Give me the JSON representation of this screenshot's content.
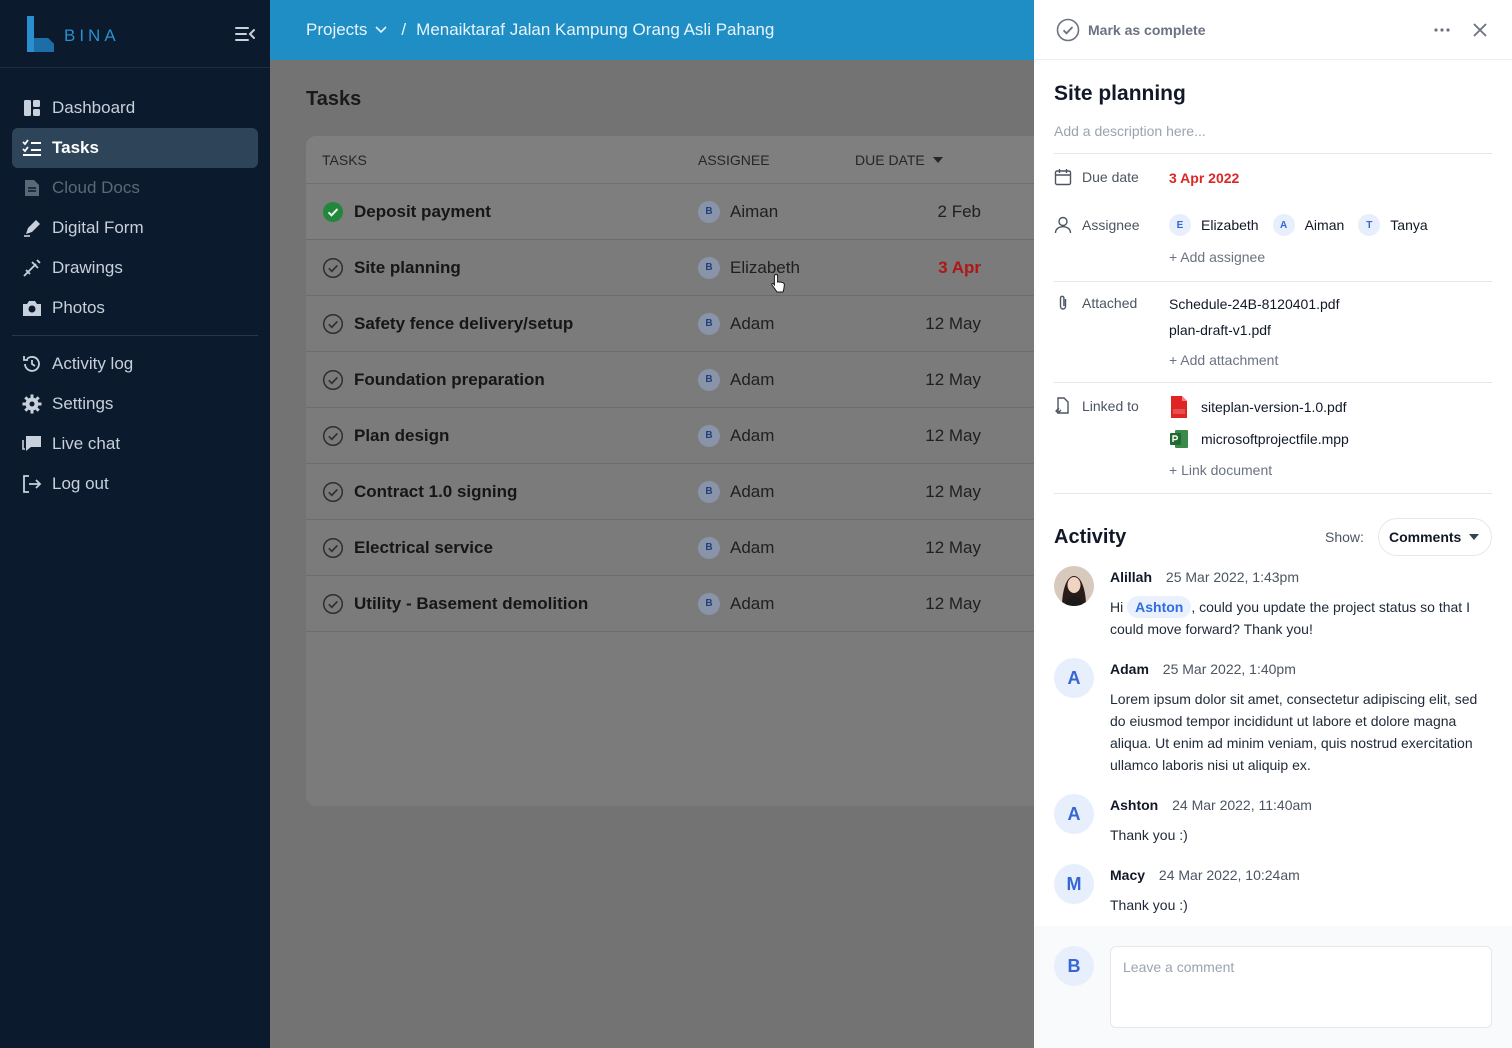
{
  "brand": {
    "name": "BINA",
    "accent": "#2a8fd0"
  },
  "sidebar": {
    "items": [
      {
        "label": "Dashboard",
        "icon": "dashboard-icon"
      },
      {
        "label": "Tasks",
        "icon": "tasks-icon",
        "active": true
      },
      {
        "label": "Cloud Docs",
        "icon": "document-icon",
        "disabled": true
      },
      {
        "label": "Digital Form",
        "icon": "pen-icon"
      },
      {
        "label": "Drawings",
        "icon": "drawing-icon"
      },
      {
        "label": "Photos",
        "icon": "camera-icon"
      },
      {
        "label": "Activity log",
        "icon": "history-icon"
      },
      {
        "label": "Settings",
        "icon": "gear-icon"
      },
      {
        "label": "Live chat",
        "icon": "chat-icon"
      },
      {
        "label": "Log out",
        "icon": "logout-icon"
      }
    ]
  },
  "topbar": {
    "breadcrumb_root": "Projects",
    "separator": "/",
    "project_name": "Menaiktaraf Jalan Kampung Orang Asli Pahang"
  },
  "main": {
    "title": "Tasks",
    "table": {
      "headers": {
        "task": "TASKS",
        "assignee": "ASSIGNEE",
        "due": "DUE DATE"
      },
      "rows": [
        {
          "task": "Deposit payment",
          "initial": "B",
          "assignee": "Aiman",
          "due": "2 Feb",
          "done": true
        },
        {
          "task": "Site planning",
          "initial": "B",
          "assignee": "Elizabeth",
          "due": "3 Apr",
          "overdue": true
        },
        {
          "task": "Safety fence delivery/setup",
          "initial": "B",
          "assignee": "Adam",
          "due": "12 May"
        },
        {
          "task": "Foundation preparation",
          "initial": "B",
          "assignee": "Adam",
          "due": "12 May"
        },
        {
          "task": "Plan design",
          "initial": "B",
          "assignee": "Adam",
          "due": "12 May"
        },
        {
          "task": "Contract 1.0 signing",
          "initial": "B",
          "assignee": "Adam",
          "due": "12 May"
        },
        {
          "task": "Electrical service",
          "initial": "B",
          "assignee": "Adam",
          "due": "12 May"
        },
        {
          "task": "Utility - Basement demolition",
          "initial": "B",
          "assignee": "Adam",
          "due": "12 May"
        }
      ]
    }
  },
  "panel": {
    "mark_complete": "Mark as complete",
    "title": "Site planning",
    "description_placeholder": "Add a description here...",
    "due_label": "Due date",
    "due_value": "3 Apr 2022",
    "assignee_label": "Assignee",
    "assignees": [
      {
        "initial": "E",
        "name": "Elizabeth"
      },
      {
        "initial": "A",
        "name": "Aiman"
      },
      {
        "initial": "T",
        "name": "Tanya"
      }
    ],
    "add_assignee": "+ Add assignee",
    "attached_label": "Attached",
    "attachments": [
      "Schedule-24B-8120401.pdf",
      "plan-draft-v1.pdf"
    ],
    "add_attachment": "+ Add attachment",
    "linked_label": "Linked to",
    "linked_docs": [
      {
        "name": "siteplan-version-1.0.pdf",
        "icon": "pdf-file-icon"
      },
      {
        "name": "microsoftprojectfile.mpp",
        "icon": "project-file-icon"
      }
    ],
    "link_document": "+ Link document",
    "activity_title": "Activity",
    "show_label": "Show:",
    "show_value": "Comments",
    "comments": [
      {
        "author": "Alillah",
        "time": "25 Mar 2022, 1:43pm",
        "pre": "Hi",
        "mention": "Ashton",
        "post": ", could you update the project status so that I could move forward? Thank you!",
        "photo": true
      },
      {
        "author": "Adam",
        "initial": "A",
        "time": "25 Mar 2022, 1:40pm",
        "text": "Lorem ipsum dolor sit amet, consectetur adipiscing elit, sed do eiusmod tempor incididunt ut labore et dolore magna aliqua. Ut enim ad minim veniam, quis nostrud exercitation ullamco laboris nisi ut aliquip ex."
      },
      {
        "author": "Ashton",
        "initial": "A",
        "time": "24 Mar 2022, 11:40am",
        "text": "Thank you :)"
      },
      {
        "author": "Macy",
        "initial": "M",
        "time": "24 Mar 2022, 10:24am",
        "text": "Thank you :)"
      }
    ],
    "composer_initial": "B",
    "comment_placeholder": "Leave a comment"
  }
}
